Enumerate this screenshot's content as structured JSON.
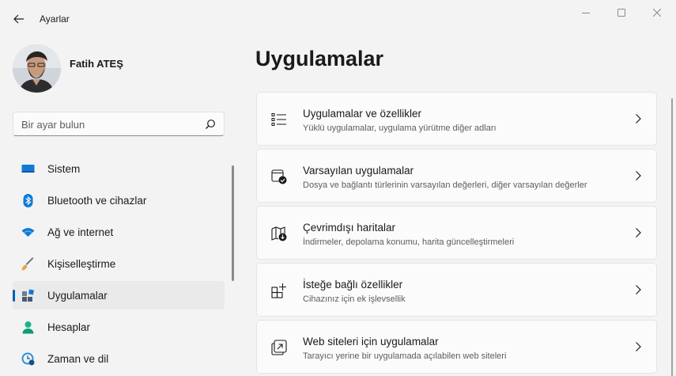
{
  "window": {
    "app_title": "Ayarlar"
  },
  "profile": {
    "name": "Fatih ATEŞ"
  },
  "search": {
    "placeholder": "Bir ayar bulun"
  },
  "nav": {
    "items": [
      {
        "label": "Sistem",
        "icon": "monitor-icon",
        "active": false
      },
      {
        "label": "Bluetooth ve cihazlar",
        "icon": "bluetooth-icon",
        "active": false
      },
      {
        "label": "Ağ ve internet",
        "icon": "wifi-icon",
        "active": false
      },
      {
        "label": "Kişiselleştirme",
        "icon": "paintbrush-icon",
        "active": false
      },
      {
        "label": "Uygulamalar",
        "icon": "apps-icon",
        "active": true
      },
      {
        "label": "Hesaplar",
        "icon": "person-icon",
        "active": false
      },
      {
        "label": "Zaman ve dil",
        "icon": "clock-globe-icon",
        "active": false
      }
    ]
  },
  "main": {
    "title": "Uygulamalar",
    "cards": [
      {
        "title": "Uygulamalar ve özellikler",
        "subtitle": "Yüklü uygulamalar, uygulama yürütme diğer adları",
        "icon": "list-icon"
      },
      {
        "title": "Varsayılan uygulamalar",
        "subtitle": "Dosya ve bağlantı türlerinin varsayılan değerleri, diğer varsayılan değerler",
        "icon": "default-app-icon"
      },
      {
        "title": "Çevrimdışı haritalar",
        "subtitle": "İndirmeler, depolama konumu, harita güncelleştirmeleri",
        "icon": "map-download-icon"
      },
      {
        "title": "İsteğe bağlı özellikler",
        "subtitle": "Cihazınız için ek işlevsellik",
        "icon": "add-grid-icon"
      },
      {
        "title": "Web siteleri için uygulamalar",
        "subtitle": "Tarayıcı yerine bir uygulamada açılabilen web siteleri",
        "icon": "open-external-icon"
      }
    ]
  },
  "colors": {
    "accent": "#005fb8",
    "background": "#f3f3f3",
    "card": "#fbfbfb"
  }
}
